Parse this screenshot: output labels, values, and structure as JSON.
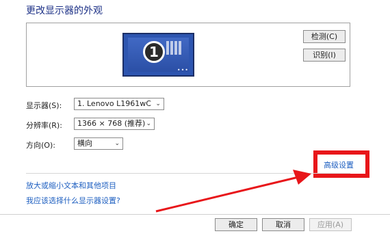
{
  "title": "更改显示器的外观",
  "preview": {
    "monitor_number": "1",
    "detect_label": "检测(C)",
    "identify_label": "识别(I)"
  },
  "settings": {
    "display": {
      "label": "显示器(S):",
      "value": "1. Lenovo L1961wC"
    },
    "resolution": {
      "label": "分辨率(R):",
      "value": "1366 × 768 (推荐)"
    },
    "orientation": {
      "label": "方向(O):",
      "value": "横向"
    }
  },
  "advanced_link": "高级设置",
  "links": {
    "text_size": "放大或缩小文本和其他项目",
    "which_settings": "我应该选择什么显示器设置?"
  },
  "buttons": {
    "ok": "确定",
    "cancel": "取消",
    "apply": "应用(A)"
  },
  "colors": {
    "highlight": "#e8161a",
    "link": "#1e5fc0",
    "title": "#1e3287"
  }
}
